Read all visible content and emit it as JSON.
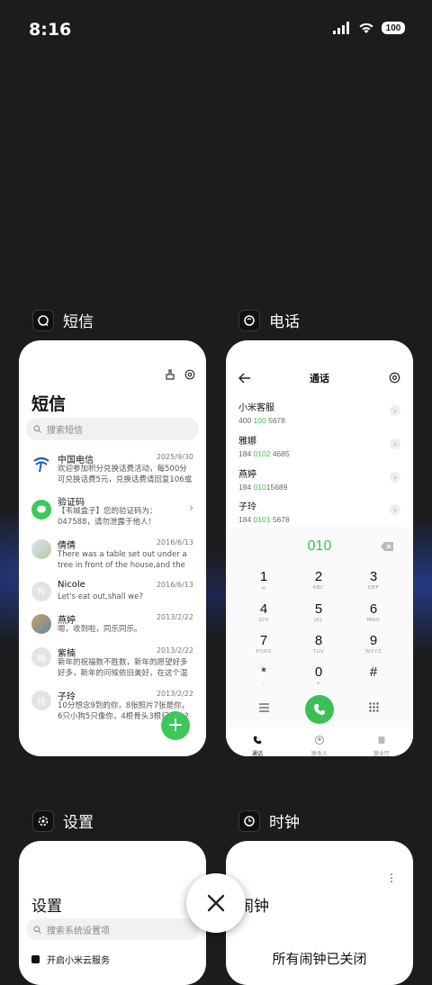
{
  "status_bar": {
    "time": "8:16",
    "battery": "100"
  },
  "sms": {
    "app_name": "短信",
    "title": "短信",
    "search_placeholder": "搜索短信",
    "messages": [
      {
        "name": "中国电信",
        "date": "2025/9/30",
        "preview": "欢迎参加积分兑换话费活动，每500分可兑换话费5元，兑换话费请回复106或jfdh#话费..."
      },
      {
        "name": "验证码",
        "date": "",
        "preview": "【韦城盒子】您的验证码为：047588，请勿泄露于他人！"
      },
      {
        "name": "倩倩",
        "date": "2016/6/13",
        "preview": "There was a table set out under a tree in front of the house,and the March Hare an..."
      },
      {
        "name": "Nicole",
        "date": "2016/6/13",
        "preview": "Let's eat out,shall we?",
        "avatar": "N"
      },
      {
        "name": "燕婷",
        "date": "2013/2/22",
        "preview": "嗯，收到啦，同乐同乐。"
      },
      {
        "name": "紫楠",
        "date": "2013/2/22",
        "preview": "新年的祝福数不胜数，新年的愿望好多好多，新年的问候依旧美好，在这个温馨的时刻，...",
        "avatar": "楠"
      },
      {
        "name": "子玲",
        "date": "2013/2/22",
        "preview": "10分想念9到的你，8张照片7张是你，6只小狗5只像你，4根骨头3根归你，2爪看11...",
        "avatar": "玲"
      }
    ]
  },
  "phone": {
    "app_name": "电话",
    "title": "通话",
    "contacts": [
      {
        "name": "小米客服",
        "num_pre": "400 ",
        "num_hl": "100",
        "num_post": " 5678"
      },
      {
        "name": "雅娜",
        "num_pre": "184 ",
        "num_hl": "0102",
        "num_post": " 4685"
      },
      {
        "name": "燕婷",
        "num_pre": "184 ",
        "num_hl": "010",
        "num_post": "15689"
      },
      {
        "name": "子玲",
        "num_pre": "184 ",
        "num_hl": "0101",
        "num_post": " 5678"
      }
    ],
    "dial_number": "010",
    "keys": [
      {
        "d": "1",
        "l": "ω"
      },
      {
        "d": "2",
        "l": "ABC"
      },
      {
        "d": "3",
        "l": "DEF"
      },
      {
        "d": "4",
        "l": "GHI"
      },
      {
        "d": "5",
        "l": "JKL"
      },
      {
        "d": "6",
        "l": "MNO"
      },
      {
        "d": "7",
        "l": "PQRS"
      },
      {
        "d": "8",
        "l": "TUV"
      },
      {
        "d": "9",
        "l": "WXYZ"
      },
      {
        "d": "*",
        "l": ","
      },
      {
        "d": "0",
        "l": "+"
      },
      {
        "d": "#",
        "l": ""
      }
    ],
    "nav": [
      "通话",
      "联系人",
      "营业厅"
    ]
  },
  "settings": {
    "app_name": "设置",
    "title": "设置",
    "search_placeholder": "搜索系统设置项",
    "row1": "开启小米云服务"
  },
  "clock": {
    "app_name": "时钟",
    "title": "闹钟",
    "empty": "所有闹钟已关闭"
  },
  "colors": {
    "accent_green": "#3cbf57",
    "background": "#1c1c1e"
  }
}
